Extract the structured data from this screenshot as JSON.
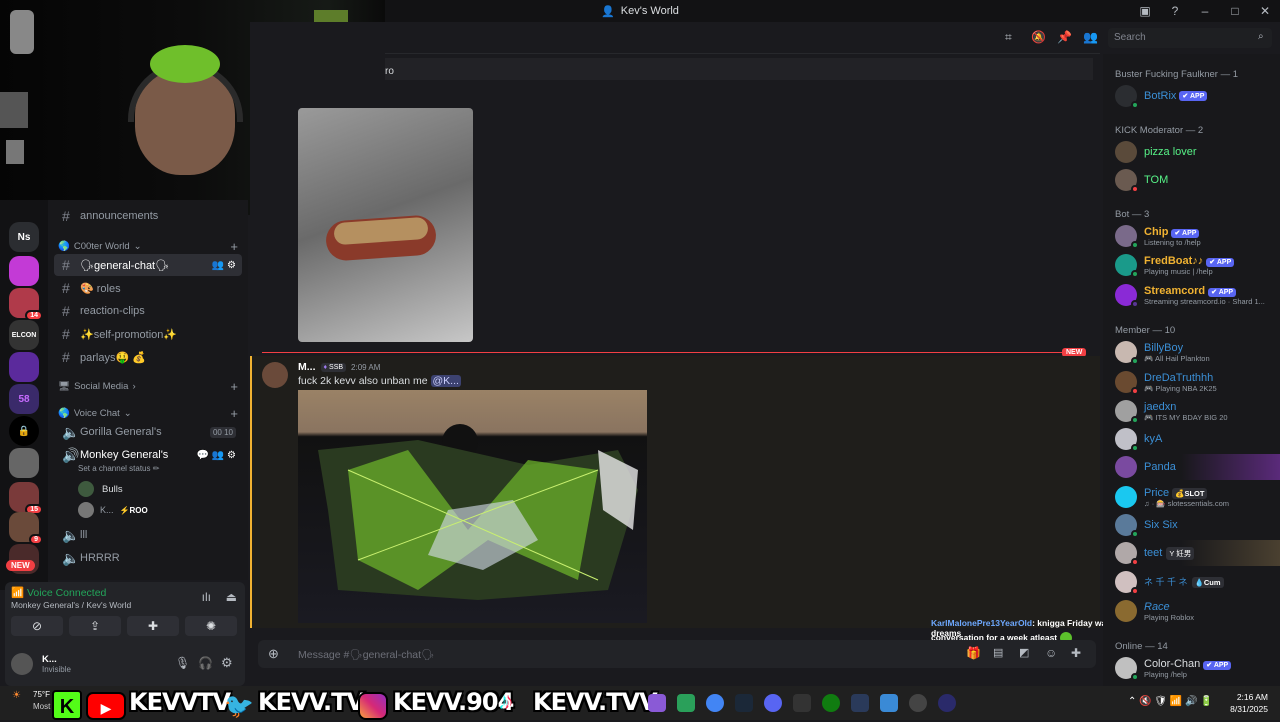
{
  "window": {
    "title": "Kev's World",
    "min": "–",
    "max": "□",
    "close": "✕"
  },
  "search": {
    "placeholder": "Search"
  },
  "server_badges": {
    "b1": "14",
    "b2": "15",
    "b3": "9",
    "new": "NEW",
    "ns": "Ns",
    "elcon": "ELCON",
    "n58": "58"
  },
  "channels": {
    "announcements": "announcements",
    "cat_cooter": "C00ter World",
    "general": "🗣general-chat🗣",
    "roles": "🎨 roles",
    "reaction": "reaction-clips",
    "selfpromo": "✨self-promotion✨",
    "parlays": "parlays🤑 💰",
    "cat_social": "Social Media",
    "cat_voice": "Voice Chat",
    "gorilla": "Gorilla General's",
    "gorilla_c1": "00",
    "gorilla_c2": "10",
    "monkey": "Monkey General's",
    "monkey_status": "Set a channel status ✏",
    "user_bulls": "Bulls",
    "user_k": "K...",
    "user_k_tag": "⚡ROO",
    "lll": "lll",
    "hrrrr": "HRRRR"
  },
  "voice": {
    "status": "Voice Connected",
    "location": "Monkey General's / Kev's World"
  },
  "user": {
    "name": "K...",
    "status": "Invisible"
  },
  "chat": {
    "top_text": "ro",
    "new_divider": "NEW",
    "author": "M...",
    "author_tag": "SSB",
    "time": "2:09 AM",
    "message_text": "fuck 2k kevv also unban me",
    "mention": "@K...",
    "input_placeholder": "Message #🗣general-chat🗣"
  },
  "stream_chat": {
    "user": "KarlMalonePre13YearOld",
    "text": ": knigga Friday was yesterday, if she was the girl of my dreams",
    "text2": "conversation for a week atleast"
  },
  "members": {
    "g1": "Buster Fucking Faulkner — 1",
    "botrix": "BotRix",
    "g2": "KICK Moderator — 2",
    "pizza": "pizza lover",
    "tom": "TOM",
    "g3": "Bot — 3",
    "chip": "Chip",
    "chip_sub": "Listening to /help",
    "fred": "FredBoat♪♪",
    "fred_sub": "Playing music | /help",
    "stream": "Streamcord",
    "stream_sub": "Streaming streamcord.io · Shard 1...",
    "g4": "Member — 10",
    "billy": "BillyBoy",
    "billy_sub": "🎮 All Hail Plankton",
    "dre": "DreDaTruthhh",
    "dre_sub": "🎮 Playing NBA 2K25",
    "jaed": "jaedxn",
    "jaed_sub": "🎮 ITS MY BDAY BIG 20",
    "kya": "kyA",
    "panda": "Panda",
    "price": "Price",
    "price_tag": "💰SLOT",
    "price_sub": "♫ · 🎰 slotessentials.com",
    "six": "Six Six",
    "teet": "teet",
    "teet_tag": "Y 妊男",
    "u9": "ネ 千 千 ネ",
    "u9_tag": "💧Cum",
    "race": "Race",
    "race_sub": "Playing Roblox",
    "g5": "Online — 14",
    "color": "Color-Chan",
    "color_sub": "Playing /help",
    "app": "APP"
  },
  "overlay": {
    "kevvtv": "KEVVTV",
    "kevvtv2": "KEVV.TV",
    "kevv904": "KEVV.904",
    "kevvtvv": "KEVV.TVV",
    "weather": "75°F",
    "weather_sub": "Most"
  },
  "clock": {
    "time": "2:16 AM",
    "date": "8/31/2025"
  }
}
